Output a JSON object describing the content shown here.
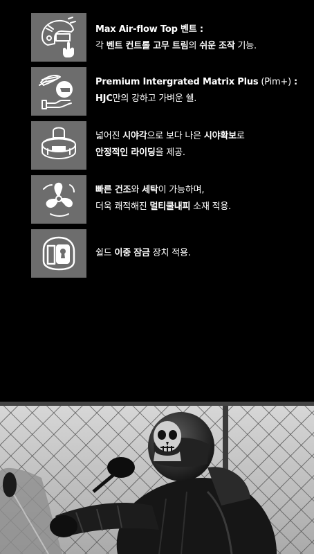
{
  "features": [
    {
      "icon": "helmet-airflow-vent-icon",
      "lines": [
        [
          {
            "t": "Max Air-flow Top ",
            "b": true
          },
          {
            "t": "벤트 :",
            "b": true
          }
        ],
        [
          {
            "t": "각 ",
            "b": false
          },
          {
            "t": "벤트 컨트롤 고무 트림",
            "b": true
          },
          {
            "t": "의 ",
            "b": false
          },
          {
            "t": "쉬운 조작",
            "b": true
          },
          {
            "t": " 기능.",
            "b": false
          }
        ]
      ]
    },
    {
      "icon": "feather-light-shell-icon",
      "lines": [
        [
          {
            "t": "Premium Intergrated Matrix Plus",
            "b": true
          },
          {
            "t": " (Pim+) ",
            "b": false
          },
          {
            "t": ":",
            "b": true
          }
        ],
        [
          {
            "t": "HJC",
            "b": true
          },
          {
            "t": "만의 강하고 가벼운 쉘.",
            "b": false
          }
        ]
      ]
    },
    {
      "icon": "wide-view-visor-icon",
      "lines": [
        [
          {
            "t": "넓어진 ",
            "b": false
          },
          {
            "t": "시야각",
            "b": true
          },
          {
            "t": "으로 보다 나은 ",
            "b": false
          },
          {
            "t": "시야확보",
            "b": true
          },
          {
            "t": "로",
            "b": false
          }
        ],
        [
          {
            "t": "안정적인 라이딩",
            "b": true
          },
          {
            "t": "을 제공.",
            "b": false
          }
        ]
      ]
    },
    {
      "icon": "quick-dry-fan-icon",
      "lines": [
        [
          {
            "t": "빠른 건조",
            "b": true
          },
          {
            "t": "와 ",
            "b": false
          },
          {
            "t": "세탁",
            "b": true
          },
          {
            "t": "이 가능하며,",
            "b": false
          }
        ],
        [
          {
            "t": "더욱 쾌적해진 ",
            "b": false
          },
          {
            "t": "멀티쿨내피",
            "b": true
          },
          {
            "t": " 소재 적용.",
            "b": false
          }
        ]
      ]
    },
    {
      "icon": "shield-double-lock-icon",
      "lines": [
        [
          {
            "t": "쉴드 ",
            "b": false
          },
          {
            "t": "이중 잠금",
            "b": true
          },
          {
            "t": " 장치 적용.",
            "b": false
          }
        ]
      ]
    }
  ],
  "colors": {
    "background": "#000000",
    "icon_box": "#6d6d6d",
    "text": "#ffffff"
  },
  "photo": {
    "subject": "rider-with-skull-helmet-photo"
  }
}
